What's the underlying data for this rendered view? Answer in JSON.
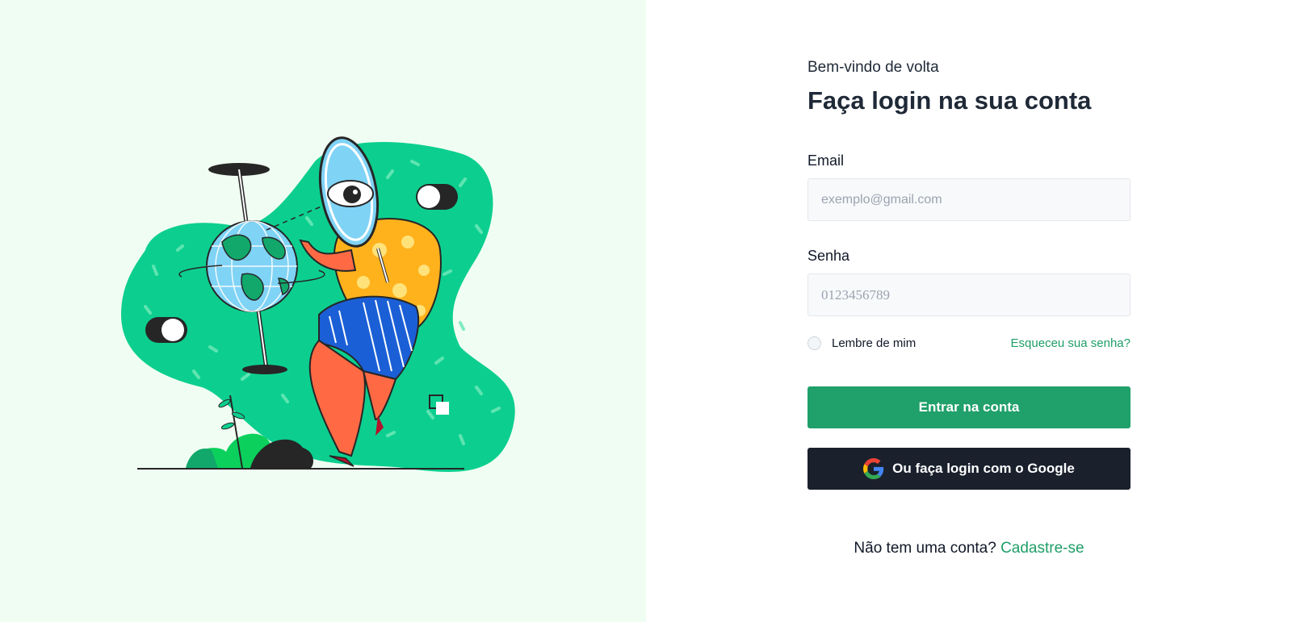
{
  "form": {
    "welcome": "Bem-vindo de volta",
    "title": "Faça login na sua conta",
    "email": {
      "label": "Email",
      "placeholder": "exemplo@gmail.com",
      "value": ""
    },
    "password": {
      "label": "Senha",
      "placeholder": "0123456789",
      "value": ""
    },
    "remember_label": "Lembre de mim",
    "forgot_label": "Esqueceu sua senha?",
    "submit_label": "Entrar na conta",
    "google_label": "Ou faça login com o Google",
    "signup_prompt": "Não tem uma conta?",
    "signup_link": "Cadastre-se"
  },
  "colors": {
    "left_background": "#f0fdf2",
    "accent_green": "#20a06a",
    "dark_button": "#1a202c",
    "illustration_blob": "#0ccf8f"
  },
  "icons": {
    "google": "google-icon",
    "illustration": "person-with-magnifier-and-globe-illustration"
  }
}
